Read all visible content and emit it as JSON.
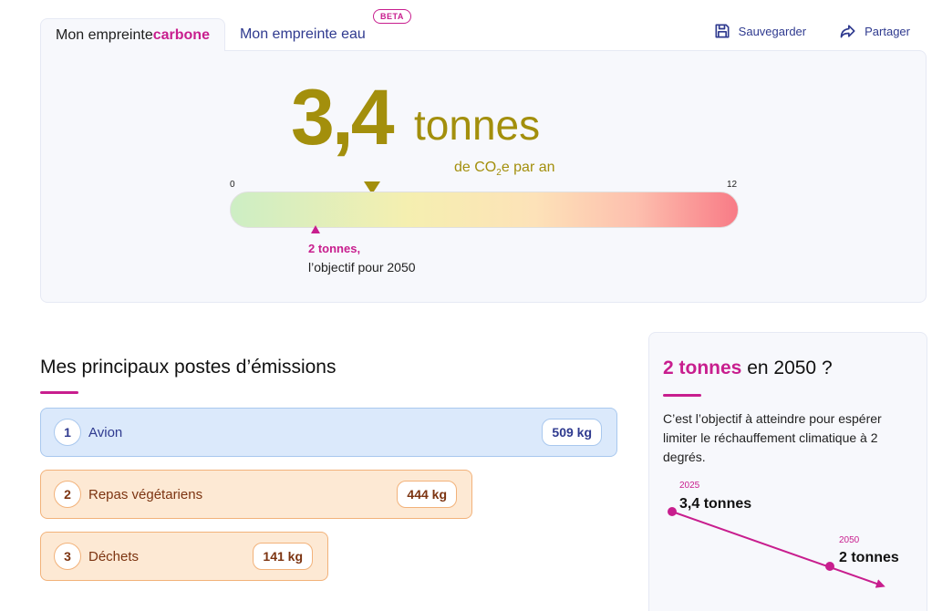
{
  "tabs": [
    {
      "label_prefix": "Mon empreinte ",
      "label_accent": "carbone",
      "active": true
    },
    {
      "label": "Mon empreinte eau",
      "badge": "BETA",
      "active": false
    }
  ],
  "actions": {
    "save_label": "Sauvegarder",
    "share_label": "Partager"
  },
  "footprint": {
    "value": "3,4",
    "unit": "tonnes",
    "subtitle_prefix": "de CO",
    "subtitle_sub": "2",
    "subtitle_suffix": "e par an",
    "scale_min": "0",
    "scale_max": "12",
    "current": 3.4,
    "goal_value": "2 tonnes,",
    "goal_label": "l’objectif pour 2050",
    "goal": 2
  },
  "emissions": {
    "title": "Mes principaux postes d’émissions",
    "items": [
      {
        "rank": "1",
        "label": "Avion",
        "value": "509 kg",
        "color": "blue"
      },
      {
        "rank": "2",
        "label": "Repas végétariens",
        "value": "444 kg",
        "color": "orange"
      },
      {
        "rank": "3",
        "label": "Déchets",
        "value": "141 kg",
        "color": "orange"
      }
    ]
  },
  "target_card": {
    "title_accent": "2 tonnes",
    "title_rest": " en 2050 ?",
    "text": "C’est l’objectif à atteindre pour espérer limiter le réchauffement climatique à 2 degrés.",
    "start_year": "2025",
    "start_value": "3,4 tonnes",
    "end_year": "2050",
    "end_value": "2 tonnes"
  },
  "colors": {
    "accent": "#c81e8e",
    "primary": "#2f3a8f",
    "footprint": "#a38f0c"
  }
}
